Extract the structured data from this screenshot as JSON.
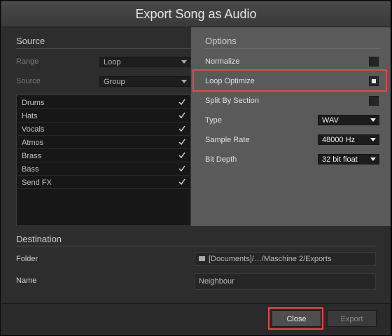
{
  "dialog": {
    "title": "Export Song as Audio"
  },
  "source": {
    "header": "Source",
    "range_label": "Range",
    "range_value": "Loop",
    "source_label": "Source",
    "source_value": "Group",
    "groups": [
      {
        "name": "Drums",
        "checked": true
      },
      {
        "name": "Hats",
        "checked": true
      },
      {
        "name": "Vocals",
        "checked": true
      },
      {
        "name": "Atmos",
        "checked": true
      },
      {
        "name": "Brass",
        "checked": true
      },
      {
        "name": "Bass",
        "checked": true
      },
      {
        "name": "Send FX",
        "checked": true
      }
    ]
  },
  "options": {
    "header": "Options",
    "normalize_label": "Normalize",
    "normalize_checked": false,
    "loop_optimize_label": "Loop Optimize",
    "loop_optimize_checked": true,
    "split_label": "Split By Section",
    "split_checked": false,
    "type_label": "Type",
    "type_value": "WAV",
    "sample_rate_label": "Sample Rate",
    "sample_rate_value": "48000 Hz",
    "bit_depth_label": "Bit Depth",
    "bit_depth_value": "32 bit float"
  },
  "destination": {
    "header": "Destination",
    "folder_label": "Folder",
    "folder_value": "[Documents]/…/Maschine 2/Exports",
    "name_label": "Name",
    "name_value": "Neighbour"
  },
  "footer": {
    "close_label": "Close",
    "export_label": "Export"
  },
  "colors": {
    "highlight": "#e04a4a",
    "options_panel": "#5a5a5a"
  }
}
